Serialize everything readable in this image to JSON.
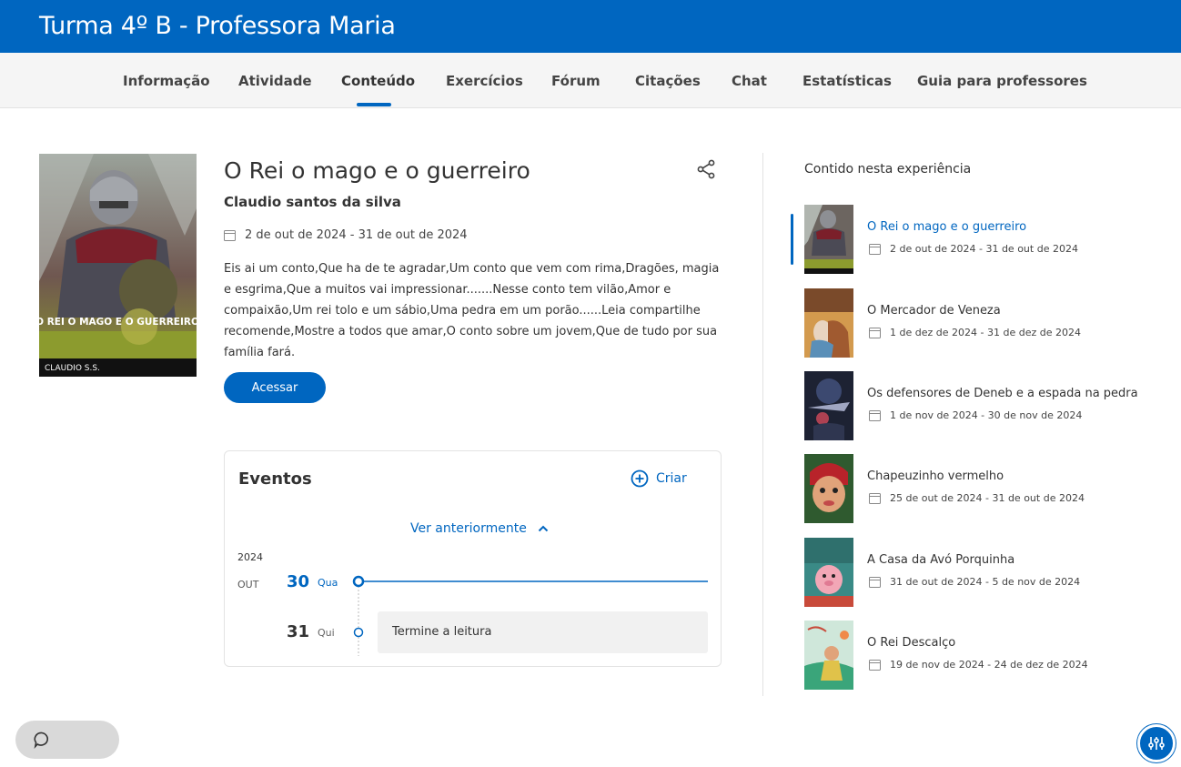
{
  "header": {
    "title": "Turma 4º B - Professora Maria"
  },
  "nav": {
    "tabs": [
      {
        "label": "Informação"
      },
      {
        "label": "Atividade"
      },
      {
        "label": "Conteúdo",
        "active": true
      },
      {
        "label": "Exercícios"
      },
      {
        "label": "Fórum"
      },
      {
        "label": "Citações"
      },
      {
        "label": "Chat"
      },
      {
        "label": "Estatísticas"
      },
      {
        "label": "Guia para professores"
      }
    ]
  },
  "book": {
    "cover_title": "O REI O MAGO E O GUERREIRO",
    "cover_author": "CLAUDIO S.S.",
    "title": "O Rei o mago e o guerreiro",
    "author": "Claudio santos da silva",
    "dates": "2 de out de 2024 - 31 de out de 2024",
    "description": "Eis ai um conto,Que ha de te agradar,Um conto que vem com rima,Dragões, magia e esgrima,Que a muitos vai impressionar.......Nesse conto tem vilão,Amor e compaixão,Um rei tolo e um sábio,Uma pedra em um porão......Leia compartilhe recomende,Mostre a todos que amar,O conto sobre um jovem,Que de tudo por sua família fará.",
    "access_label": "Acessar"
  },
  "events": {
    "title": "Eventos",
    "create_label": "Criar",
    "see_previous_label": "Ver anteriormente",
    "year": "2024",
    "month": "OUT",
    "days": [
      {
        "day": "30",
        "weekday": "Qua"
      },
      {
        "day": "31",
        "weekday": "Qui",
        "event": "Termine a leitura"
      }
    ]
  },
  "sidebar": {
    "heading": "Contido nesta experiência",
    "items": [
      {
        "title": "O Rei o mago e o guerreiro",
        "dates": "2 de out de 2024 - 31 de out de 2024",
        "active": true
      },
      {
        "title": "O Mercador de Veneza",
        "dates": "1 de dez de 2024 - 31 de dez de 2024"
      },
      {
        "title": "Os defensores de Deneb e a espada na pedra",
        "dates": "1 de nov de 2024 - 30 de nov de 2024"
      },
      {
        "title": "Chapeuzinho vermelho",
        "dates": "25 de out de 2024 - 31 de out de 2024"
      },
      {
        "title": "A Casa da Avó Porquinha",
        "dates": "31 de out de 2024 - 5 de nov de 2024"
      },
      {
        "title": "O Rei Descalço",
        "dates": "19 de nov de 2024 - 24 de dez de 2024"
      }
    ]
  },
  "colors": {
    "brand": "#0066c0",
    "nav_bg": "#f5f5f5",
    "event_bg": "#f1f1f1"
  }
}
